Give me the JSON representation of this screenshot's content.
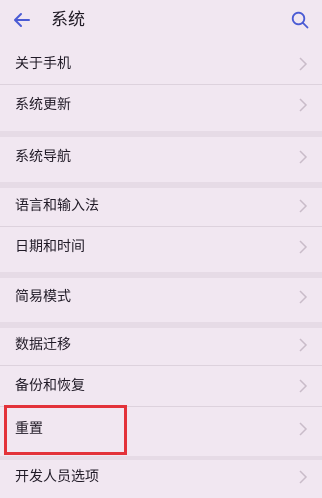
{
  "header": {
    "back_icon": "arrow-left-icon",
    "title": "系统",
    "search_icon": "search-icon"
  },
  "menu": {
    "items": [
      {
        "label": "关于手机"
      },
      {
        "label": "系统更新"
      },
      {
        "label": "系统导航"
      },
      {
        "label": "语言和输入法"
      },
      {
        "label": "日期和时间"
      },
      {
        "label": "简易模式"
      },
      {
        "label": "数据迁移"
      },
      {
        "label": "备份和恢复"
      },
      {
        "label": "重置"
      },
      {
        "label": "开发人员选项"
      }
    ],
    "chevron_icon": "chevron-right-icon"
  },
  "annotation": {
    "highlight_color": "#e3323a",
    "highlighted_item": "重置"
  },
  "colors": {
    "background": "#f1e7f1",
    "accent": "#4a5bd4"
  }
}
